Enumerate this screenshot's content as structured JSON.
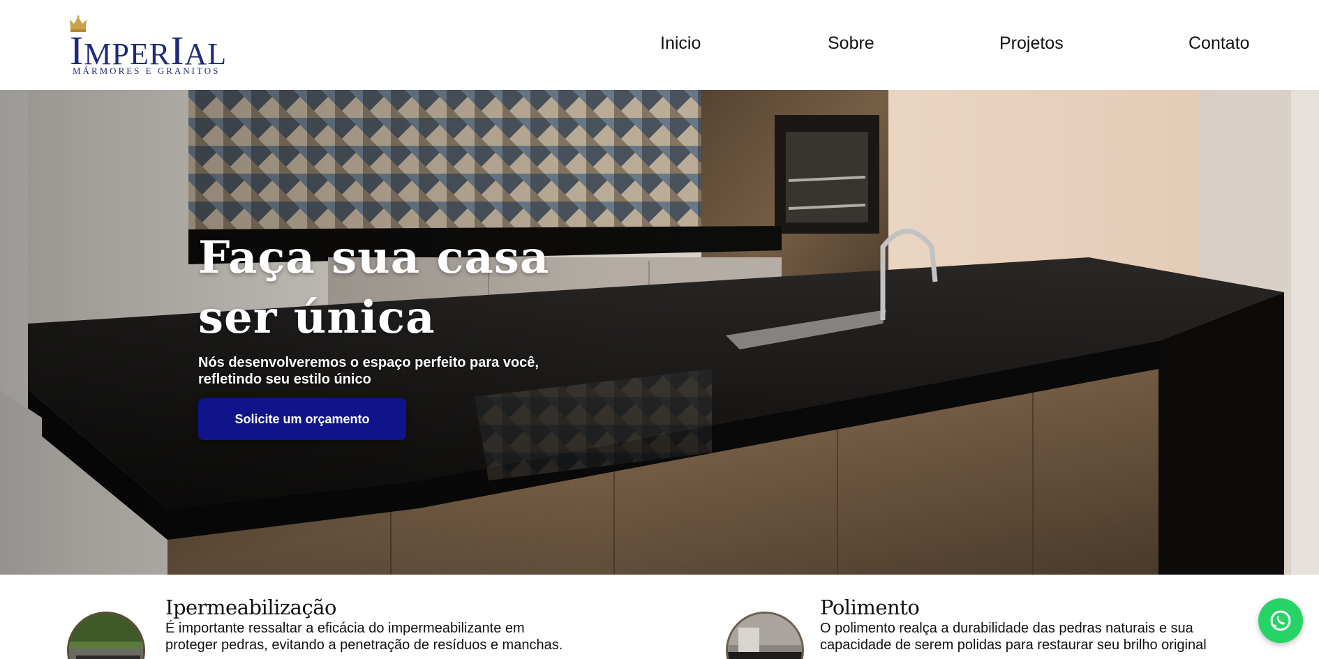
{
  "brand": {
    "name": "IMPERIAL",
    "tagline": "MÁRMORES E GRANITOS",
    "color": "#1f2b7a"
  },
  "nav": {
    "items": [
      {
        "label": "Inicio"
      },
      {
        "label": "Sobre"
      },
      {
        "label": "Projetos"
      },
      {
        "label": "Contato"
      }
    ]
  },
  "hero": {
    "title_line1": "Faça sua casa",
    "title_line2": "ser única",
    "subtitle_line1": "Nós desenvolveremos o espaço perfeito para você,",
    "subtitle_line2": "refletindo seu estilo único",
    "cta_label": "Solicite um orçamento",
    "cta_color": "#10148a"
  },
  "services": [
    {
      "title": "Ipermeabilização",
      "text_line1": "É importante ressaltar a eficácia do impermeabilizante em",
      "text_line2": "proteger pedras, evitando a penetração de resíduos e manchas.",
      "thumb_icon": "outdoor-pool-photo"
    },
    {
      "title": "Polimento",
      "text_line1": "O polimento realça a durabilidade das pedras naturais e sua",
      "text_line2": "capacidade de serem polidas para restaurar seu brilho original",
      "thumb_icon": "kitchen-photo"
    }
  ],
  "whatsapp": {
    "icon": "whatsapp-icon",
    "color": "#25d366"
  }
}
